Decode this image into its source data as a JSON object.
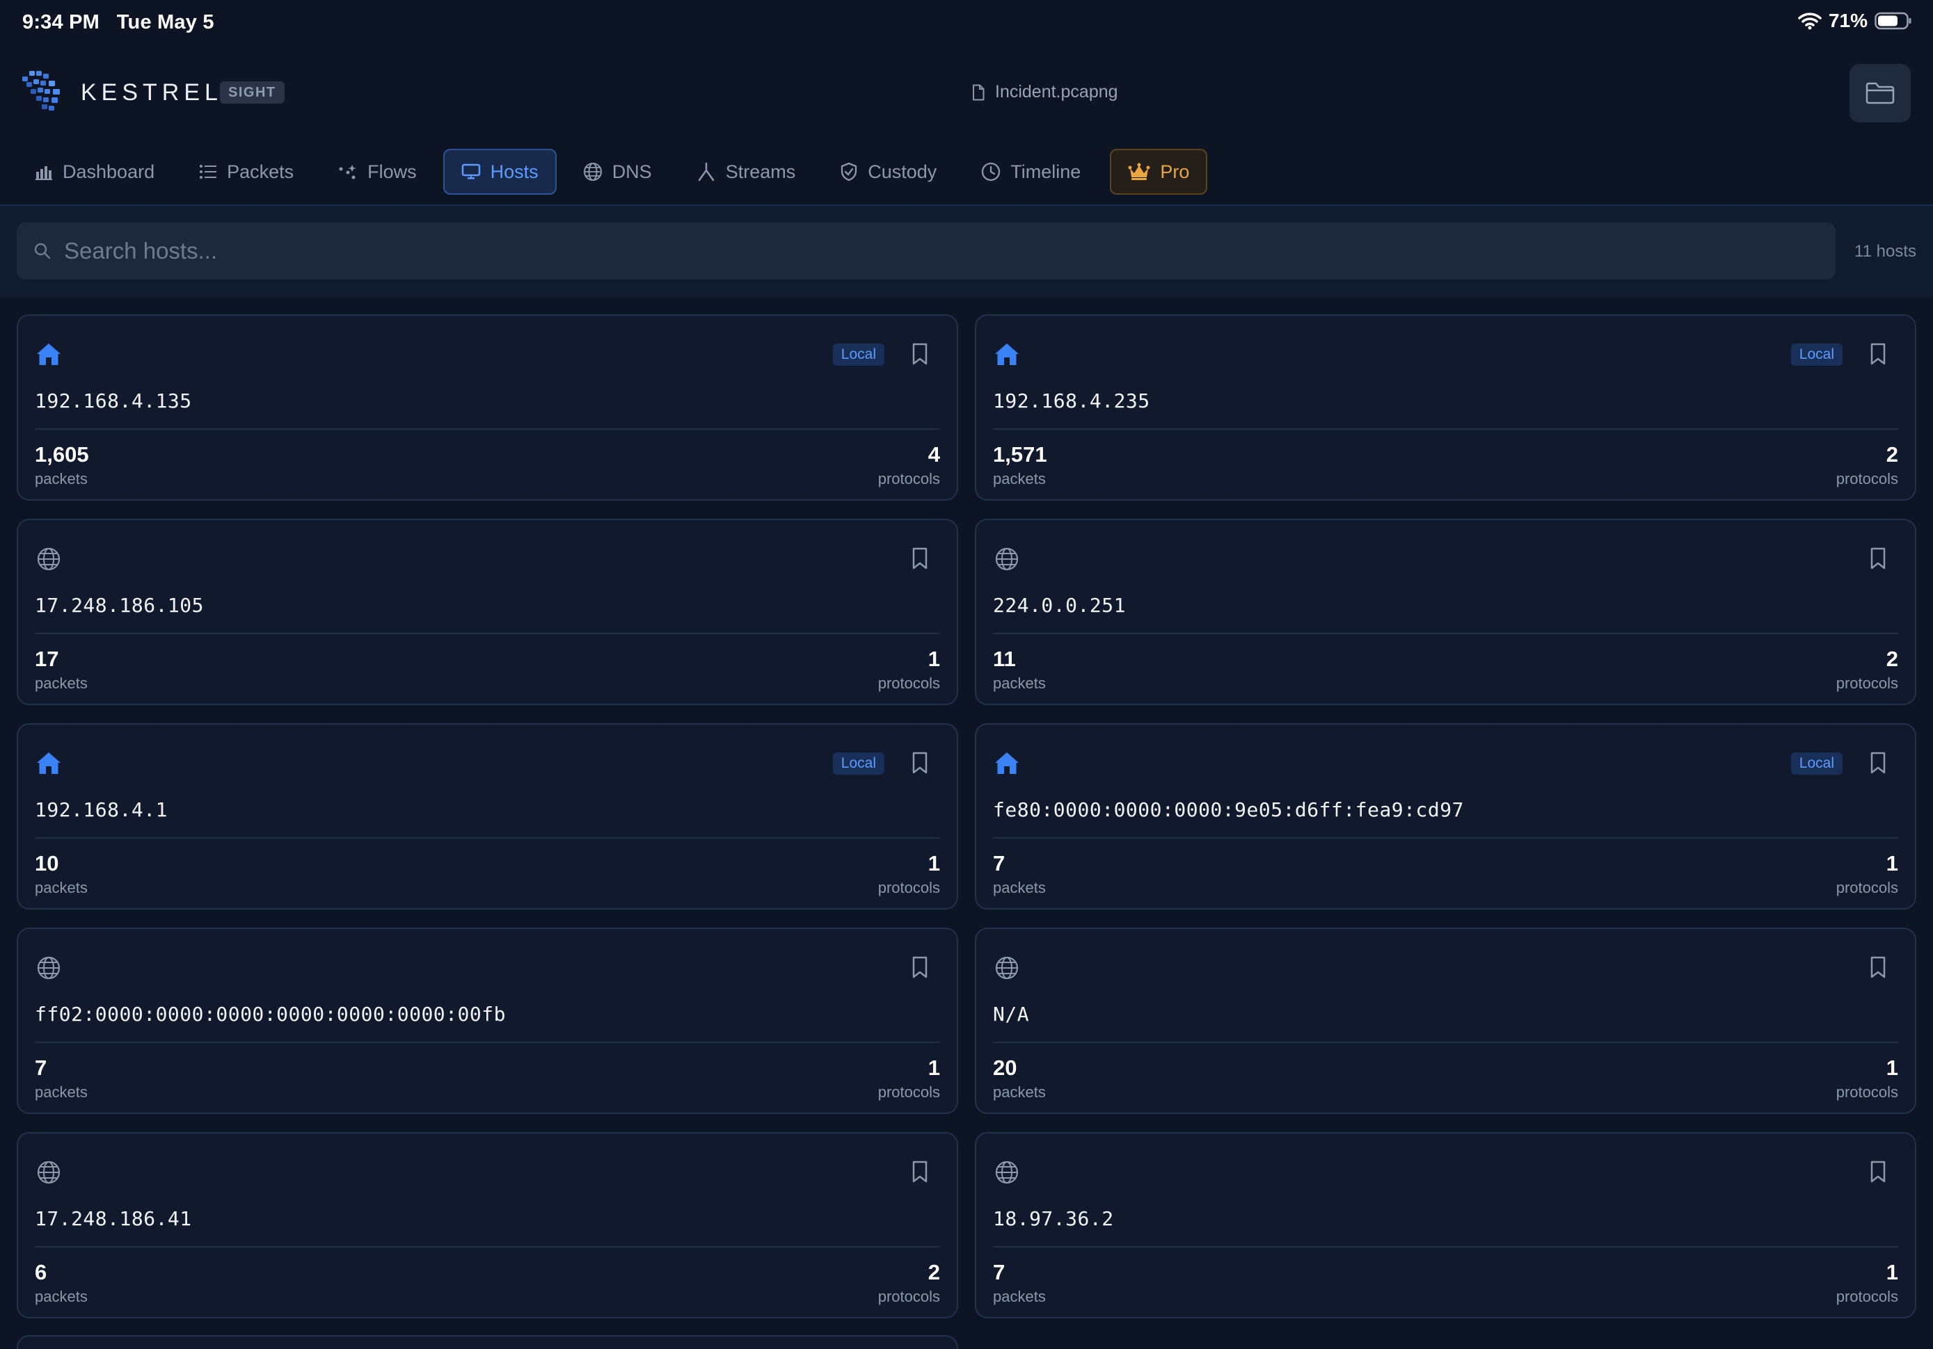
{
  "status_bar": {
    "time": "9:34 PM",
    "date": "Tue May 5",
    "battery": "71%"
  },
  "header": {
    "brand": "KESTREL",
    "badge": "SIGHT",
    "file_name": "Incident.pcapng"
  },
  "tabs": [
    {
      "label": "Dashboard",
      "icon": "bar-chart-icon"
    },
    {
      "label": "Packets",
      "icon": "list-icon"
    },
    {
      "label": "Flows",
      "icon": "flows-icon"
    },
    {
      "label": "Hosts",
      "icon": "monitor-icon",
      "active": true
    },
    {
      "label": "DNS",
      "icon": "globe-icon"
    },
    {
      "label": "Streams",
      "icon": "streams-icon"
    },
    {
      "label": "Custody",
      "icon": "shield-icon"
    },
    {
      "label": "Timeline",
      "icon": "clock-icon"
    },
    {
      "label": "Pro",
      "icon": "crown-icon"
    }
  ],
  "search": {
    "placeholder": "Search hosts...",
    "count": "11 hosts"
  },
  "hosts": [
    {
      "address": "192.168.4.135",
      "local": true,
      "local_label": "Local",
      "packets": "1,605",
      "packets_label": "packets",
      "protocols": "4",
      "protocols_label": "protocols"
    },
    {
      "address": "192.168.4.235",
      "local": true,
      "local_label": "Local",
      "packets": "1,571",
      "packets_label": "packets",
      "protocols": "2",
      "protocols_label": "protocols"
    },
    {
      "address": "17.248.186.105",
      "local": false,
      "packets": "17",
      "packets_label": "packets",
      "protocols": "1",
      "protocols_label": "protocols"
    },
    {
      "address": "224.0.0.251",
      "local": false,
      "packets": "11",
      "packets_label": "packets",
      "protocols": "2",
      "protocols_label": "protocols"
    },
    {
      "address": "192.168.4.1",
      "local": true,
      "local_label": "Local",
      "packets": "10",
      "packets_label": "packets",
      "protocols": "1",
      "protocols_label": "protocols"
    },
    {
      "address": "fe80:0000:0000:0000:9e05:d6ff:fea9:cd97",
      "local": true,
      "local_label": "Local",
      "packets": "7",
      "packets_label": "packets",
      "protocols": "1",
      "protocols_label": "protocols"
    },
    {
      "address": "ff02:0000:0000:0000:0000:0000:0000:00fb",
      "local": false,
      "packets": "7",
      "packets_label": "packets",
      "protocols": "1",
      "protocols_label": "protocols"
    },
    {
      "address": "N/A",
      "local": false,
      "packets": "20",
      "packets_label": "packets",
      "protocols": "1",
      "protocols_label": "protocols"
    },
    {
      "address": "17.248.186.41",
      "local": false,
      "packets": "6",
      "packets_label": "packets",
      "protocols": "2",
      "protocols_label": "protocols"
    },
    {
      "address": "18.97.36.2",
      "local": false,
      "packets": "7",
      "packets_label": "packets",
      "protocols": "1",
      "protocols_label": "protocols"
    }
  ],
  "colors": {
    "background": "#0d1424",
    "card": "#111a2c",
    "accent": "#3b82f6",
    "pro": "#e9a641"
  }
}
